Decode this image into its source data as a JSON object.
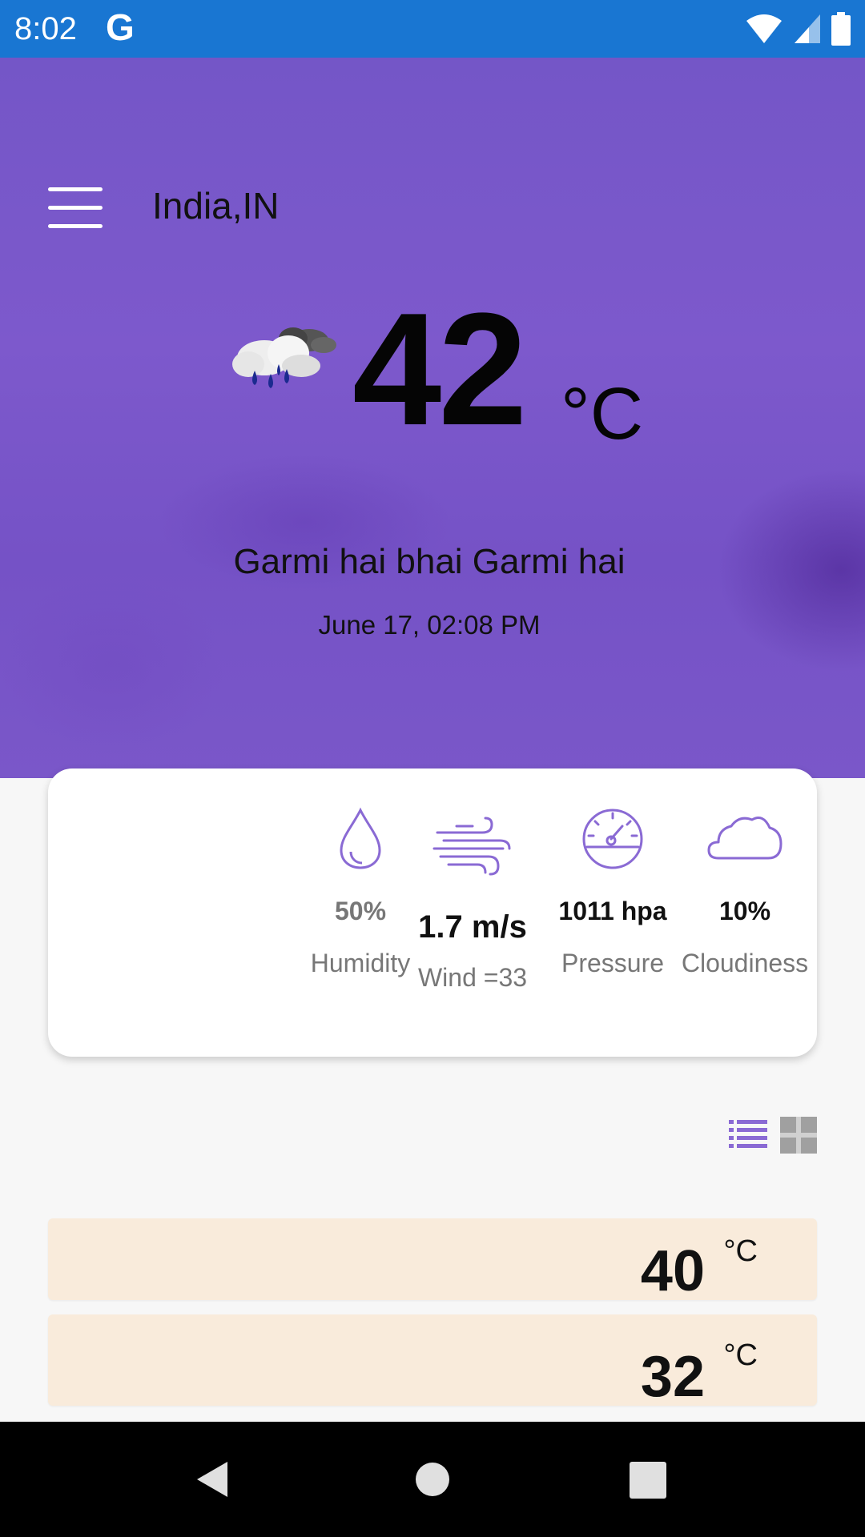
{
  "status_bar": {
    "time": "8:02",
    "app_icon": "G",
    "icons": [
      "wifi-icon",
      "signal-icon",
      "battery-icon"
    ]
  },
  "header": {
    "menu_icon": "hamburger-menu-icon",
    "location": "India,IN"
  },
  "current": {
    "weather_icon": "rain-cloud-icon",
    "temperature": "42",
    "unit": "°C",
    "description": "Garmi hai bhai Garmi hai",
    "datetime": "June 17, 02:08 PM"
  },
  "stats": {
    "humidity": {
      "icon": "droplet-icon",
      "value": "50%",
      "label": "Humidity"
    },
    "wind": {
      "icon": "wind-icon",
      "value": "1.7 m/s",
      "label": "Wind =33"
    },
    "pressure": {
      "icon": "gauge-icon",
      "value": "1011 hpa",
      "label": "Pressure"
    },
    "cloudiness": {
      "icon": "cloud-icon",
      "value": "10%",
      "label": "Cloudiness"
    }
  },
  "view_toggle": {
    "list_icon": "list-view-icon",
    "grid_icon": "grid-view-icon"
  },
  "forecast": [
    {
      "temperature": "40",
      "unit": "°C"
    },
    {
      "temperature": "32",
      "unit": "°C"
    }
  ],
  "colors": {
    "status_bar": "#1976d2",
    "hero": "#7d59cc",
    "accent": "#8a6ad4",
    "forecast_row": "#f9ebdb"
  },
  "nav_bar": {
    "back": "back-icon",
    "home": "home-icon",
    "recents": "recents-icon"
  }
}
